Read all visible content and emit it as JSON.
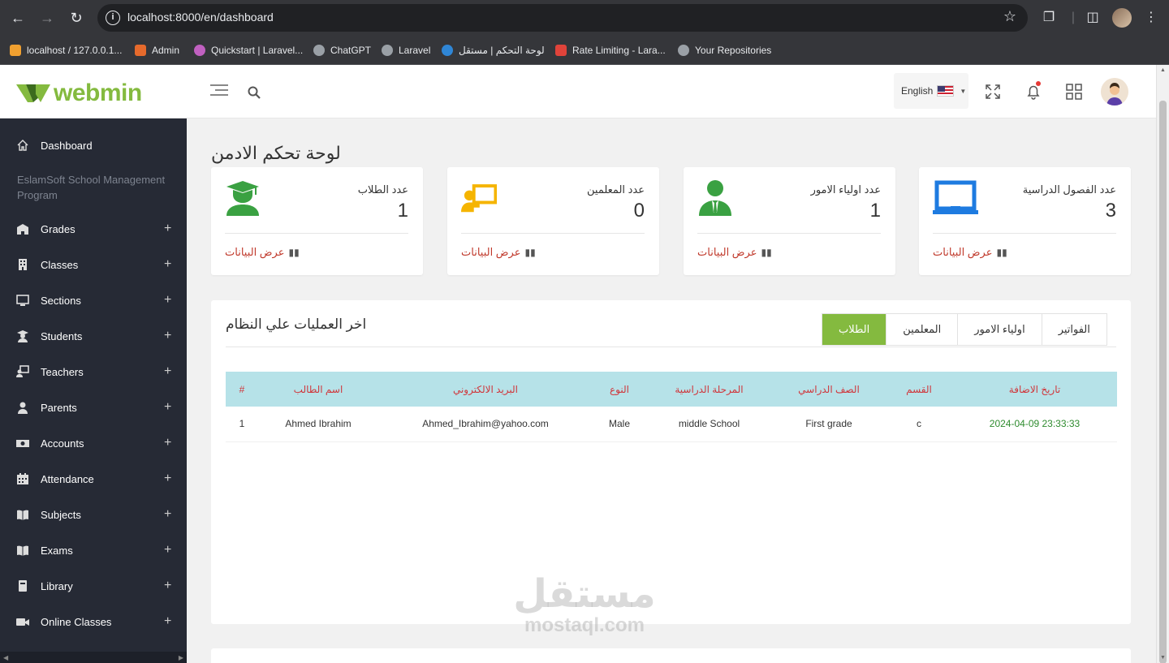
{
  "browser": {
    "url": "localhost:8000/en/dashboard",
    "bookmarks": [
      {
        "label": "localhost / 127.0.0.1...",
        "color": "#f0a030"
      },
      {
        "label": "Admin",
        "color": "#e66a2c"
      },
      {
        "label": "Quickstart | Laravel...",
        "color": "#c060c0"
      },
      {
        "label": "ChatGPT",
        "color": "#9aa0a6"
      },
      {
        "label": "Laravel",
        "color": "#9aa0a6"
      },
      {
        "label": "لوحة التحكم | مستقل",
        "color": "#2f86d6"
      },
      {
        "label": "Rate Limiting - Lara...",
        "color": "#e0433a"
      },
      {
        "label": "Your Repositories",
        "color": "#9aa0a6"
      }
    ]
  },
  "header": {
    "logo_text": "webmin",
    "language": "English",
    "brand_color": "#84ba3f"
  },
  "sidebar": {
    "dashboard_label": "Dashboard",
    "section_heading": "EslamSoft School Management Program",
    "items": [
      {
        "label": "Grades",
        "icon": "building-icon"
      },
      {
        "label": "Classes",
        "icon": "building-icon"
      },
      {
        "label": "Sections",
        "icon": "monitor-icon"
      },
      {
        "label": "Students",
        "icon": "graduate-icon"
      },
      {
        "label": "Teachers",
        "icon": "teacher-icon"
      },
      {
        "label": "Parents",
        "icon": "user-icon"
      },
      {
        "label": "Accounts",
        "icon": "money-icon"
      },
      {
        "label": "Attendance",
        "icon": "calendar-icon"
      },
      {
        "label": "Subjects",
        "icon": "book-icon"
      },
      {
        "label": "Exams",
        "icon": "book-open-icon"
      },
      {
        "label": "Library",
        "icon": "book-icon"
      },
      {
        "label": "Online Classes",
        "icon": "video-icon"
      }
    ]
  },
  "main": {
    "page_title": "لوحة تحكم الادمن",
    "stats": [
      {
        "label": "عدد الطلاب",
        "value": "1",
        "link": "عرض البيانات",
        "icon": "graduate-icon",
        "color": "#3aa142"
      },
      {
        "label": "عدد المعلمين",
        "value": "0",
        "link": "عرض البيانات",
        "icon": "teacher-board-icon",
        "color": "#f5b400"
      },
      {
        "label": "عدد اولياء الامور",
        "value": "1",
        "link": "عرض البيانات",
        "icon": "parent-icon",
        "color": "#3aa142"
      },
      {
        "label": "عدد الفصول الدراسية",
        "value": "3",
        "link": "عرض البيانات",
        "icon": "classroom-icon",
        "color": "#1e7be0"
      }
    ],
    "activity": {
      "title": "اخر العمليات علي النظام",
      "tabs": [
        "الطلاب",
        "المعلمين",
        "اولياء الامور",
        "الفواتير"
      ],
      "active_tab": "الطلاب",
      "columns": [
        "#",
        "اسم الطالب",
        "البريد الالكتروني",
        "النوع",
        "المرحلة الدراسية",
        "الصف الدراسي",
        "القسم",
        "تاريخ الاضافة"
      ],
      "rows": [
        [
          "1",
          "Ahmed Ibrahim",
          "Ahmed_Ibrahim@yahoo.com",
          "Male",
          "middle School",
          "First grade",
          "c",
          "2024-04-09 23:33:33"
        ]
      ]
    }
  },
  "watermark": {
    "arabic": "مستقل",
    "latin": "mostaql.com"
  }
}
